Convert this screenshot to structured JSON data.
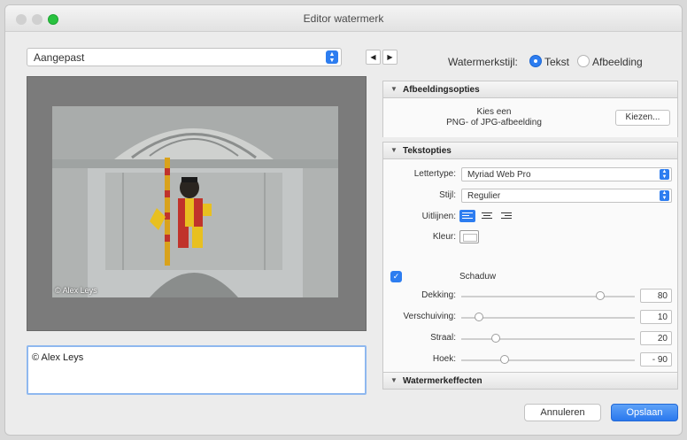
{
  "window": {
    "title": "Editor watermerk"
  },
  "toolbar": {
    "preset_value": "Aangepast",
    "prev_glyph": "◀",
    "next_glyph": "▶",
    "style_label": "Watermerkstijl:",
    "style_options": [
      "Tekst",
      "Afbeelding"
    ],
    "style_selected": "Tekst"
  },
  "preview": {
    "watermark_overlay": "© Alex Leys"
  },
  "watermark_input": {
    "value": "© Alex Leys"
  },
  "image_options": {
    "header": "Afbeeldingsopties",
    "desc_line1": "Kies een",
    "desc_line2": "PNG- of JPG-afbeelding",
    "choose_button": "Kiezen..."
  },
  "text_options": {
    "header": "Tekstopties",
    "font_label": "Lettertype:",
    "font_value": "Myriad Web Pro",
    "style_label": "Stijl:",
    "style_value": "Regulier",
    "align_label": "Uitlijnen:",
    "color_label": "Kleur:",
    "text_color": "#ffffff",
    "shadow_enabled": true,
    "shadow_label": "Schaduw",
    "sliders": [
      {
        "label": "Dekking:",
        "value": "80",
        "fraction": 0.8
      },
      {
        "label": "Verschuiving:",
        "value": "10",
        "fraction": 0.1
      },
      {
        "label": "Straal:",
        "value": "20",
        "fraction": 0.2
      },
      {
        "label": "Hoek:",
        "value": "- 90",
        "fraction": 0.25
      }
    ]
  },
  "effects": {
    "header": "Watermerkeffecten"
  },
  "footer": {
    "cancel_button": "Annuleren",
    "ok_button": "Opslaan"
  },
  "colors": {
    "accent": "#2d7df0"
  }
}
